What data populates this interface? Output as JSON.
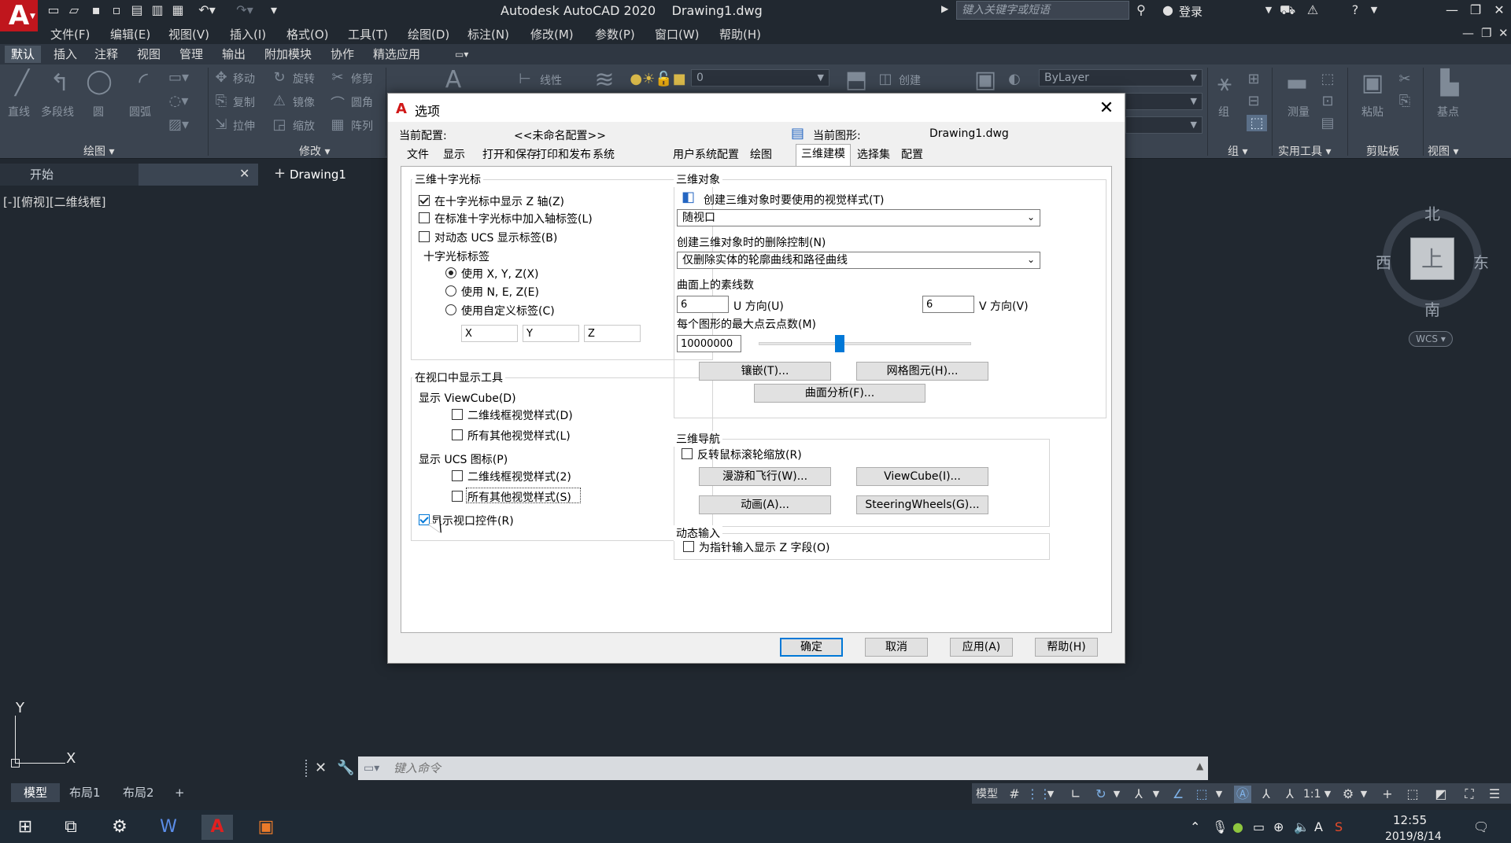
{
  "app": {
    "title": "Autodesk AutoCAD 2020    Drawing1.dwg",
    "search_placeholder": "键入关键字或短语",
    "login": "登录",
    "colors": {
      "background": "#212830",
      "ribbon": "#3b4450",
      "accent": "#0078d7",
      "logo": "#c0161d"
    }
  },
  "menu": [
    "文件(F)",
    "编辑(E)",
    "视图(V)",
    "插入(I)",
    "格式(O)",
    "工具(T)",
    "绘图(D)",
    "标注(N)",
    "修改(M)",
    "参数(P)",
    "窗口(W)",
    "帮助(H)"
  ],
  "ribbon": {
    "tabs": [
      "默认",
      "插入",
      "注释",
      "视图",
      "管理",
      "输出",
      "附加模块",
      "协作",
      "精选应用"
    ],
    "draw_tools": [
      "直线",
      "多段线",
      "圆",
      "圆弧"
    ],
    "modify_tools": [
      "移动",
      "旋转",
      "修剪",
      "复制",
      "镜像",
      "圆角",
      "拉伸",
      "缩放",
      "阵列"
    ],
    "layer_tools": [
      "线性"
    ],
    "layer_value": "0",
    "block_create": "创建",
    "bylayer": "ByLayer",
    "right_tools": [
      "组",
      "测量",
      "粘贴",
      "基点"
    ],
    "panels": [
      "绘图 ▾",
      "修改 ▾",
      "组 ▾",
      "实用工具 ▾",
      "剪贴板",
      "视图 ▾"
    ]
  },
  "doc_tabs": {
    "start": "开始",
    "drawing": "Drawing1"
  },
  "viewport": {
    "label": "[-][俯视][二维线框]",
    "compass": {
      "north": "北",
      "south": "南",
      "east": "东",
      "west": "西"
    },
    "cube_face": "上",
    "wcs": "WCS",
    "ucs_x": "X",
    "ucs_y": "Y"
  },
  "command": {
    "placeholder": "键入命令"
  },
  "layout_tabs": [
    "模型",
    "布局1",
    "布局2"
  ],
  "status": {
    "model": "模型",
    "scale": "1:1"
  },
  "taskbar": {
    "time": "12:55",
    "date": "2019/8/14"
  },
  "dialog": {
    "title": "选项",
    "current_profile_label": "当前配置:",
    "current_profile_value": "<<未命名配置>>",
    "current_drawing_label": "当前图形:",
    "current_drawing_value": "Drawing1.dwg",
    "tabs": [
      "文件",
      "显示",
      "打开和保存",
      "打印和发布",
      "系统",
      "用户系统配置",
      "绘图",
      "三维建模",
      "选择集",
      "配置"
    ],
    "crosshair": {
      "title": "三维十字光标",
      "show_z": "在十字光标中显示 Z 轴(Z)",
      "axis_labels": "在标准十字光标中加入轴标签(L)",
      "dynamic_ucs": "对动态 UCS 显示标签(B)",
      "labels_title": "十字光标标签",
      "xyz": "使用 X, Y, Z(X)",
      "nez": "使用 N, E, Z(E)",
      "custom": "使用自定义标签(C)",
      "custom_x": "X",
      "custom_y": "Y",
      "custom_z": "Z"
    },
    "viewport_tools": {
      "title": "在视口中显示工具",
      "viewcube": "显示 ViewCube(D)",
      "vc_2d": "二维线框视觉样式(D)",
      "vc_other": "所有其他视觉样式(L)",
      "ucs_icon": "显示 UCS 图标(P)",
      "ucs_2d": "二维线框视觉样式(2)",
      "ucs_other": "所有其他视觉样式(S)",
      "viewport_controls": "显示视口控件(R)"
    },
    "objects": {
      "title": "三维对象",
      "visual_style_label": "创建三维对象时要使用的视觉样式(T)",
      "visual_style_value": "随视口",
      "deletion_label": "创建三维对象时的删除控制(N)",
      "deletion_value": "仅删除实体的轮廓曲线和路径曲线",
      "isolines_label": "曲面上的素线数",
      "u_value": "6",
      "u_label": "U 方向(U)",
      "v_value": "6",
      "v_label": "V 方向(V)",
      "pointcloud_label": "每个图形的最大点云点数(M)",
      "pointcloud_value": "10000000",
      "pointcloud_slider": 0.38,
      "tessellation": "镶嵌(T)...",
      "mesh": "网格图元(H)...",
      "surface_analysis": "曲面分析(F)..."
    },
    "navigation": {
      "title": "三维导航",
      "reverse_wheel": "反转鼠标滚轮缩放(R)",
      "walk_fly": "漫游和飞行(W)...",
      "viewcube": "ViewCube(I)...",
      "animation": "动画(A)...",
      "steering": "SteeringWheels(G)..."
    },
    "dynamic_input": {
      "title": "动态输入",
      "z_field": "为指针输入显示 Z 字段(O)"
    },
    "buttons": {
      "ok": "确定",
      "cancel": "取消",
      "apply": "应用(A)",
      "help": "帮助(H)"
    }
  }
}
